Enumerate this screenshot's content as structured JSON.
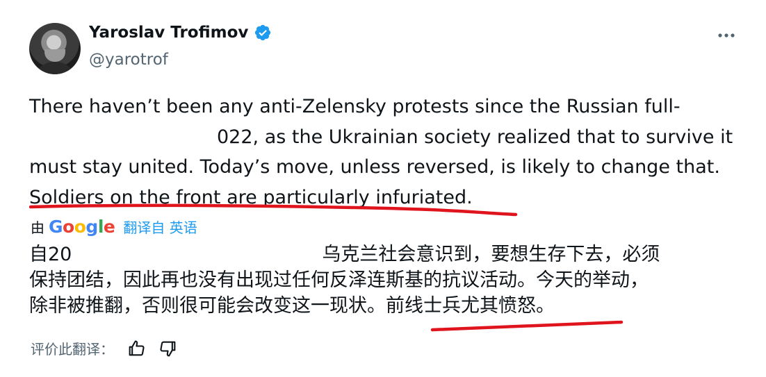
{
  "author": {
    "name": "Yaroslav Trofimov",
    "handle": "@yarotrof",
    "verified": true,
    "avatar_icon": "profile-photo"
  },
  "tweet": {
    "lines": [
      "There haven’t been any anti-Zelensky protests since the Russian full-",
      "022, as the Ukrainian society realized that to survive it",
      "must stay united. Today’s move, unless reversed, is likely to change that.",
      "Soldiers on the front are particularly infuriated."
    ]
  },
  "translation_bar": {
    "by_label": "由",
    "google_letters": [
      "G",
      "o",
      "o",
      "g",
      "l",
      "e"
    ],
    "link_label": "翻译自 英语"
  },
  "translation": {
    "lines": [
      "自20",
      "乌克兰社会意识到，要想生存下去，必须",
      "保持团结，因此再也没有出现过任何反泽连斯基的抗议活动。今天的举动，",
      "除非被推翻，否则很可能会改变这一现状。前线士兵尤其愤怒。"
    ],
    "line1_tail_offset_note": ""
  },
  "rating": {
    "label": "评价此翻译：",
    "thumbs_up_icon": "thumbs-up-icon",
    "thumbs_down_icon": "thumbs-down-icon"
  },
  "colors": {
    "accent_blue": "#1d9bf0",
    "annotation_red": "#e0141c",
    "muted_text": "#536471"
  }
}
